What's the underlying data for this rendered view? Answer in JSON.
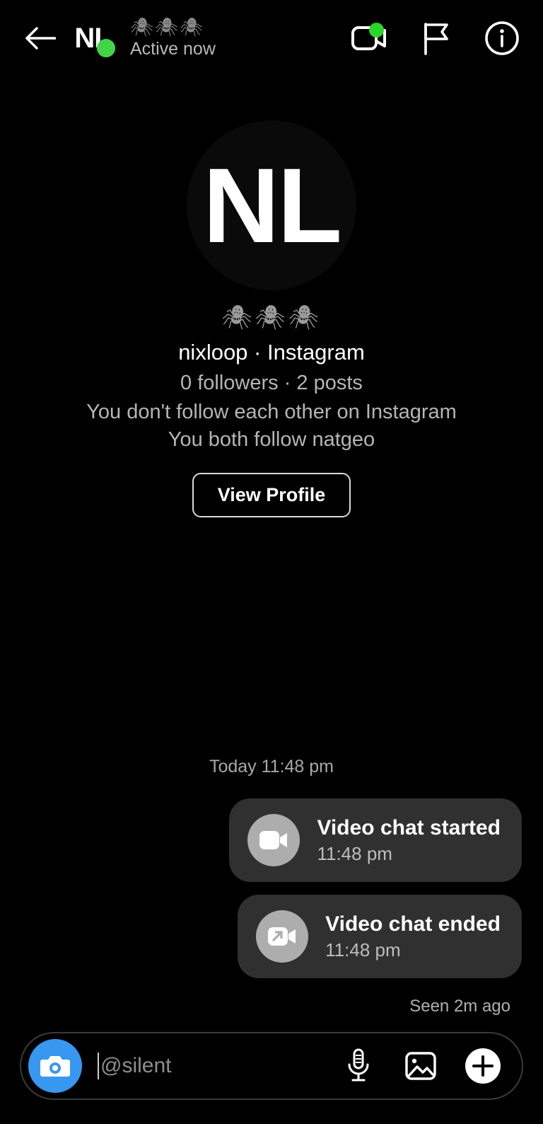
{
  "header": {
    "back_icon": "back-arrow-icon",
    "avatar_initials": "NL",
    "presence_emoji": "🕷🕷🕷",
    "presence_status": "Active now",
    "video_call_icon": "video-camera-icon",
    "flag_icon": "flag-icon",
    "info_icon": "info-circle-icon",
    "online_badge_color": "#42D545",
    "video_badge_color": "#2BD62B"
  },
  "intro": {
    "avatar_initials": "NL",
    "emoji_row": "🕷🕷🕷",
    "name_line": "nixloop · Instagram",
    "stats": "0 followers · 2 posts",
    "relationship": "You don't follow each other on Instagram",
    "mutual": "You both follow natgeo",
    "view_profile_label": "View Profile"
  },
  "conversation": {
    "day_stamp": "Today 11:48 pm",
    "messages": [
      {
        "icon": "video-camera-icon",
        "title": "Video chat started",
        "time": "11:48 pm"
      },
      {
        "icon": "video-camera-leave-icon",
        "title": "Video chat ended",
        "time": "11:48 pm"
      }
    ],
    "receipt": "Seen 2m ago"
  },
  "composer": {
    "camera_icon": "camera-icon",
    "placeholder": "@silent",
    "mic_icon": "microphone-icon",
    "gallery_icon": "image-icon",
    "plus_icon": "plus-icon",
    "camera_button_color": "#3897F0"
  }
}
